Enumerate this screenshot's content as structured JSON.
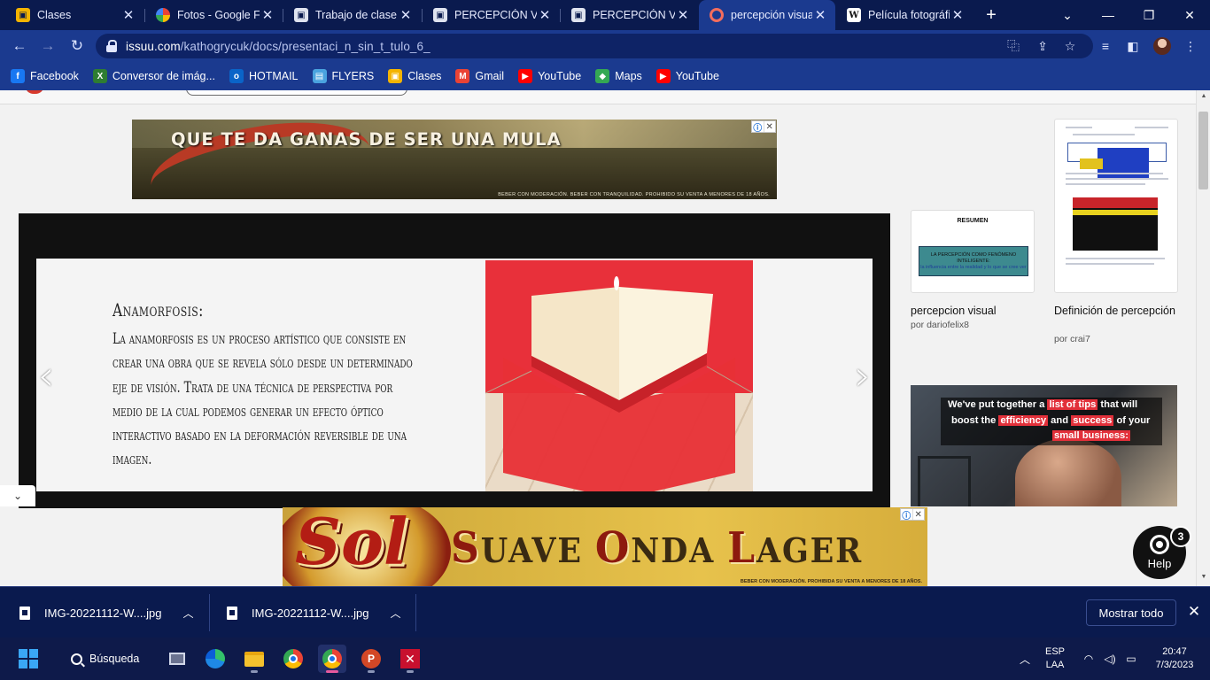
{
  "tabs": [
    {
      "title": "Clases",
      "icon": "classroom-icon",
      "active": false
    },
    {
      "title": "Fotos - Google F",
      "icon": "photos-icon",
      "active": false
    },
    {
      "title": "Trabajo de clase",
      "icon": "classroom-icon",
      "active": false
    },
    {
      "title": "PERCEPCIÓN VIS",
      "icon": "classroom-icon",
      "active": false
    },
    {
      "title": "PERCEPCIÓN VIS",
      "icon": "classroom-icon",
      "active": false
    },
    {
      "title": "percepción visua",
      "icon": "issuu-icon",
      "active": true
    },
    {
      "title": "Película fotográfi",
      "icon": "wikipedia-icon",
      "active": false
    }
  ],
  "window_controls": {
    "tab_search": "⌄",
    "minimize": "—",
    "maximize": "❐",
    "close": "✕",
    "new_tab": "+"
  },
  "address_bar": {
    "host": "issuu.com",
    "path": "/kathogrycuk/docs/presentaci_n_sin_t_tulo_6_"
  },
  "bookmarks": [
    {
      "label": "Facebook",
      "icon": "facebook-icon",
      "color": "#1877f2",
      "glyph": "f"
    },
    {
      "label": "Conversor de imág...",
      "icon": "image-converter-icon",
      "color": "#2e7d32",
      "glyph": "X"
    },
    {
      "label": "HOTMAIL",
      "icon": "outlook-icon",
      "color": "#0a64c8",
      "glyph": "o"
    },
    {
      "label": "FLYERS",
      "icon": "flyers-icon",
      "color": "#4aa3df",
      "glyph": "▤"
    },
    {
      "label": "Clases",
      "icon": "classroom-icon",
      "color": "#f4b400",
      "glyph": "▣"
    },
    {
      "label": "Gmail",
      "icon": "gmail-icon",
      "color": "#ea4335",
      "glyph": "M"
    },
    {
      "label": "YouTube",
      "icon": "youtube-icon",
      "color": "#ff0000",
      "glyph": "▶"
    },
    {
      "label": "Maps",
      "icon": "maps-icon",
      "color": "#34a853",
      "glyph": "◆"
    },
    {
      "label": "YouTube",
      "icon": "youtube-icon",
      "color": "#ff0000",
      "glyph": "▶"
    }
  ],
  "ads": {
    "top": {
      "headline": "QUE TE DA GANAS DE SER UNA MULA",
      "legal": "BEBER CON MODERACIÓN. BEBER CON TRANQUILIDAD. PROHIBIDO SU VENTA A MENORES DE 18 AÑOS."
    },
    "side": {
      "line1_pre": "We've put together a ",
      "line1_hl": "list of tips",
      "line1_post": " that will",
      "line2_pre": "boost the ",
      "line2_hl1": "efficiency",
      "line2_mid": " and ",
      "line2_hl2": "success",
      "line2_post": " of your",
      "line3_hl": "small business:"
    },
    "bottom": {
      "brand": "Sol",
      "slogan_words": [
        [
          "S",
          "UAVE"
        ],
        [
          "O",
          "NDA"
        ],
        [
          "L",
          "AGER"
        ]
      ],
      "legal": "BEBER CON MODERACIÓN. PROHIBIDA SU VENTA A MENORES DE 18 AÑOS."
    },
    "badge_info": "ⓘ",
    "badge_close": "✕"
  },
  "slide": {
    "title": "Anamorfosis:",
    "body": "La anamorfosis es un proceso artístico que consiste en crear una obra que se revela sólo desde un determinado eje de visión. Trata de una técnica de perspectiva por medio de la cual podemos generar un efecto óptico interactivo basado en la deformación reversible de una imagen.",
    "prev": "‹",
    "next": "›"
  },
  "related": [
    {
      "title": "percepcion visual",
      "author": "por dariofelix8",
      "thumb_heading": "RESUMEN",
      "thumb_box_line1": "LA PERCEPCIÓN COMO FENÓMENO",
      "thumb_box_line2": "INTELIGENTE:",
      "thumb_box_line3": "la influencia entre la realidad y lo que se cree ver"
    },
    {
      "title": "Definición de percepción",
      "author": "por crai7"
    }
  ],
  "help": {
    "label": "Help",
    "count": "3"
  },
  "downloads": {
    "items": [
      {
        "name": "IMG-20221112-W....jpg"
      },
      {
        "name": "IMG-20221112-W....jpg"
      }
    ],
    "show_all": "Mostrar todo",
    "close": "✕"
  },
  "taskbar": {
    "search": "Búsqueda",
    "lang_top": "ESP",
    "lang_bottom": "LAA",
    "time": "20:47",
    "date": "7/3/2023"
  }
}
